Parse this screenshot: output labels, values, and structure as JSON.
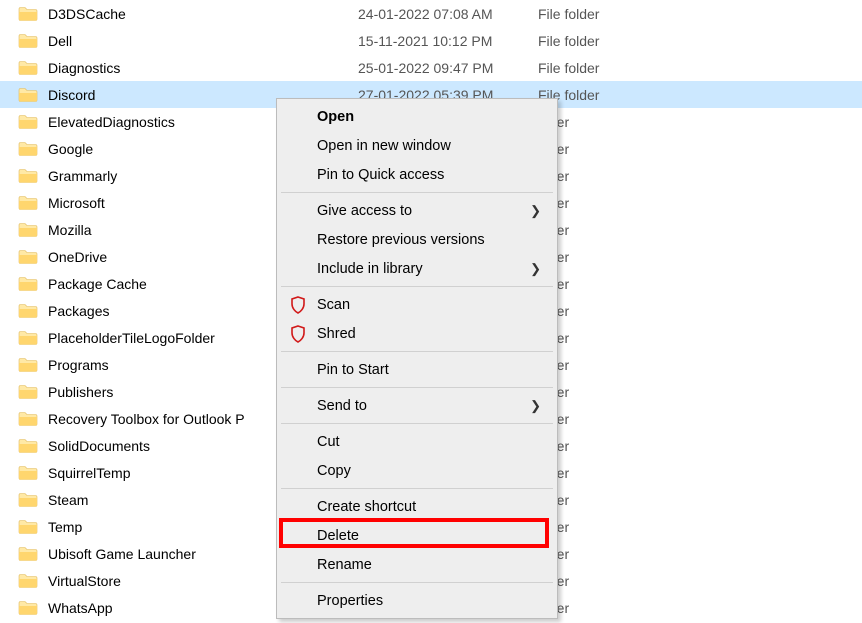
{
  "files": [
    {
      "name": "D3DSCache",
      "date": "24-01-2022 07:08 AM",
      "type": "File folder",
      "selected": false
    },
    {
      "name": "Dell",
      "date": "15-11-2021 10:12 PM",
      "type": "File folder",
      "selected": false
    },
    {
      "name": "Diagnostics",
      "date": "25-01-2022 09:47 PM",
      "type": "File folder",
      "selected": false
    },
    {
      "name": "Discord",
      "date": "27-01-2022 05:39 PM",
      "type": "File folder",
      "selected": true
    },
    {
      "name": "ElevatedDiagnostics",
      "date": "",
      "type": "older",
      "selected": false
    },
    {
      "name": "Google",
      "date": "",
      "type": "older",
      "selected": false
    },
    {
      "name": "Grammarly",
      "date": "",
      "type": "older",
      "selected": false
    },
    {
      "name": "Microsoft",
      "date": "",
      "type": "older",
      "selected": false
    },
    {
      "name": "Mozilla",
      "date": "",
      "type": "older",
      "selected": false
    },
    {
      "name": "OneDrive",
      "date": "",
      "type": "older",
      "selected": false
    },
    {
      "name": "Package Cache",
      "date": "",
      "type": "older",
      "selected": false
    },
    {
      "name": "Packages",
      "date": "",
      "type": "older",
      "selected": false
    },
    {
      "name": "PlaceholderTileLogoFolder",
      "date": "",
      "type": "older",
      "selected": false
    },
    {
      "name": "Programs",
      "date": "",
      "type": "older",
      "selected": false
    },
    {
      "name": "Publishers",
      "date": "",
      "type": "older",
      "selected": false
    },
    {
      "name": "Recovery Toolbox for Outlook P",
      "date": "",
      "type": "older",
      "selected": false
    },
    {
      "name": "SolidDocuments",
      "date": "",
      "type": "older",
      "selected": false
    },
    {
      "name": "SquirrelTemp",
      "date": "",
      "type": "older",
      "selected": false
    },
    {
      "name": "Steam",
      "date": "",
      "type": "older",
      "selected": false
    },
    {
      "name": "Temp",
      "date": "",
      "type": "older",
      "selected": false
    },
    {
      "name": "Ubisoft Game Launcher",
      "date": "",
      "type": "older",
      "selected": false
    },
    {
      "name": "VirtualStore",
      "date": "",
      "type": "older",
      "selected": false
    },
    {
      "name": "WhatsApp",
      "date": "",
      "type": "older",
      "selected": false
    }
  ],
  "menu": {
    "open": "Open",
    "open_new_window": "Open in new window",
    "pin_quick_access": "Pin to Quick access",
    "give_access": "Give access to",
    "restore_versions": "Restore previous versions",
    "include_library": "Include in library",
    "scan": "Scan",
    "shred": "Shred",
    "pin_start": "Pin to Start",
    "send_to": "Send to",
    "cut": "Cut",
    "copy": "Copy",
    "create_shortcut": "Create shortcut",
    "delete": "Delete",
    "rename": "Rename",
    "properties": "Properties"
  },
  "highlighted_menu_item": "delete"
}
